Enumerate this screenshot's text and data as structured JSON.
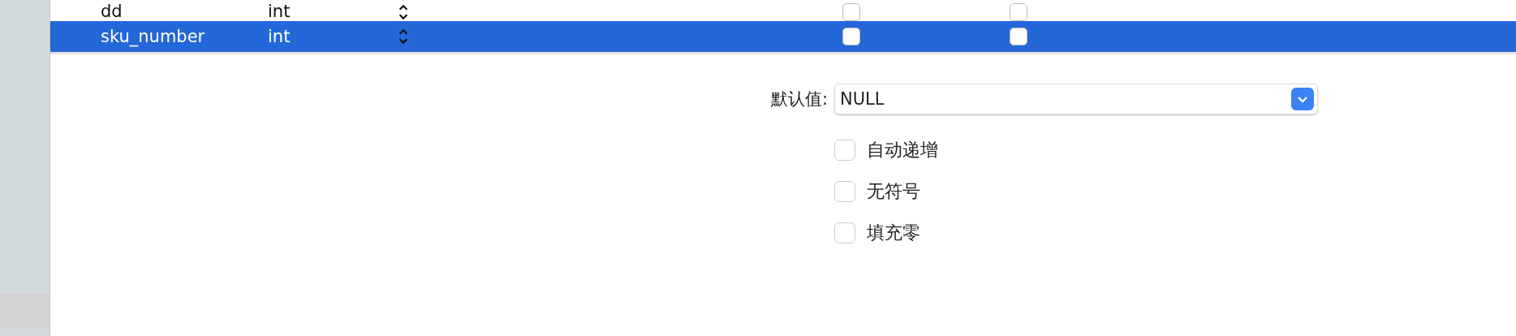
{
  "table": {
    "rows": [
      {
        "name": "dd",
        "type": "int",
        "selected": false,
        "flag_1": false,
        "flag_2": false
      },
      {
        "name": "sku_number",
        "type": "int",
        "selected": true,
        "flag_1": false,
        "flag_2": false
      }
    ]
  },
  "details": {
    "default_label": "默认值:",
    "default_value": "NULL",
    "options": [
      {
        "label": "自动递增",
        "checked": false
      },
      {
        "label": "无符号",
        "checked": false
      },
      {
        "label": "填充零",
        "checked": false
      }
    ]
  }
}
